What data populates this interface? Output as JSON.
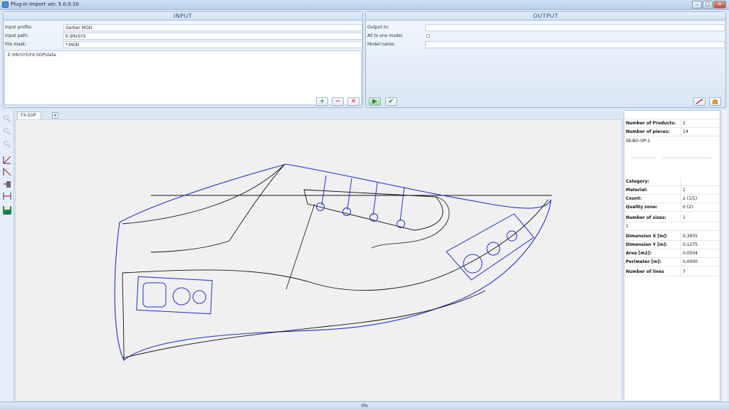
{
  "window": {
    "title": "Plug-in Import ver. 5.0.0.10",
    "min": "–",
    "max": "□",
    "close": "✕"
  },
  "input": {
    "header": "INPUT",
    "profile_label": "Input profile:",
    "profile_value": "Gerber MOD",
    "path_label": "Input path:",
    "path_value": "E:\\MirSYS",
    "mask_label": "File mask:",
    "mask_value": "*.MOD",
    "list_items": [
      "E:\\MirSYS\\FX-SOP\\data"
    ],
    "add_glyph": "+",
    "remove_glyph": "−",
    "delete_glyph": "✕"
  },
  "output": {
    "header": "OUTPUT",
    "output_to_label": "Output to:",
    "output_to_value": "",
    "all_to_one_label": "All to one model",
    "model_name_label": "Model name:",
    "model_name_value": "",
    "run_glyph": "▶",
    "check_glyph": "✔"
  },
  "tabs": [
    {
      "label": "FX-SOP"
    }
  ],
  "tab_close_glyph": "x",
  "properties": {
    "num_products_label": "Number of Products:",
    "num_products_value": "2",
    "num_pieces_label": "Number of pieces:",
    "num_pieces_value": "14",
    "piece_name": "SK-BO-OP-1",
    "category_label": "Category:",
    "category_value": "",
    "material_label": "Material:",
    "material_value": "1",
    "count_label": "Count:",
    "count_value": "2 (1/1)",
    "quality_label": "Quality zone:",
    "quality_value": "0 (2)",
    "num_sizes_label": "Number of sizes:",
    "num_sizes_value": "1",
    "size_value": "1",
    "dim_x_label": "Dimension X [m]:",
    "dim_x_value": "0,3955",
    "dim_y_label": "Dimension Y [m]:",
    "dim_y_value": "0,1275",
    "area_label": "Area [m2]:",
    "area_value": "0,0504",
    "perimeter_label": "Perimeter [m]:",
    "perimeter_value": "0,0000",
    "num_lines_label": "Number of lines",
    "num_lines_value": "7"
  },
  "status": {
    "progress_text": "0%"
  },
  "colors": {
    "outline_blue": "#1f2fd1",
    "outline_black": "#111111",
    "accent": "#2b4a78"
  }
}
